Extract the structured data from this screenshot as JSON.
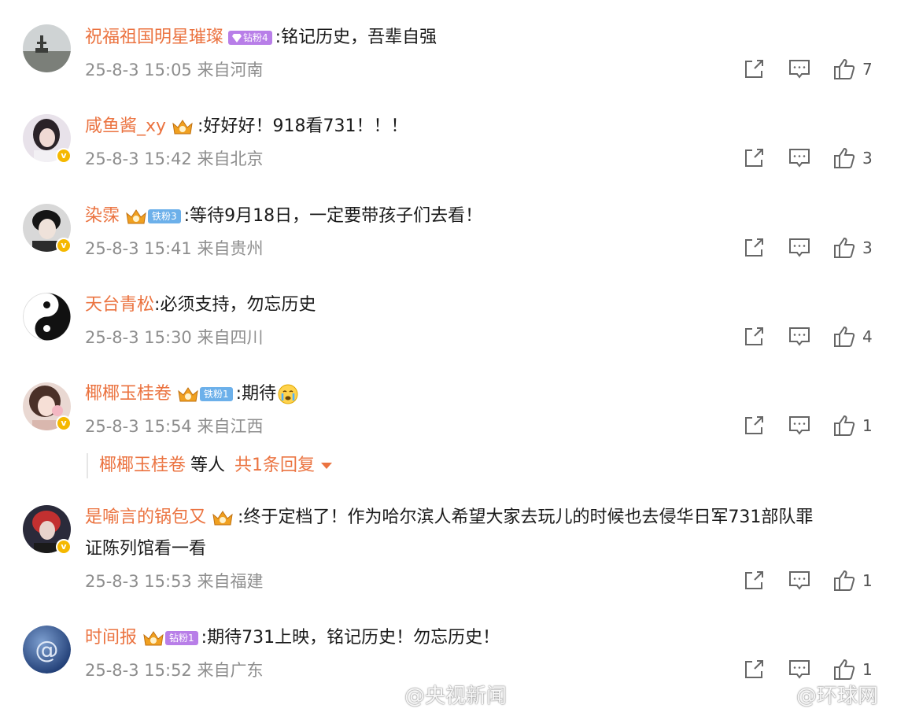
{
  "comments": [
    {
      "username": "祝福祖国明星璀璨",
      "fan_badge": {
        "crown": false,
        "type": "diamond-gem",
        "label": "钻粉4"
      },
      "text": "铭记历史，吾辈自强",
      "time": "25-8-3 15:05",
      "location": "来自河南",
      "likes": "7",
      "verified": false
    },
    {
      "username": "咸鱼酱_xy",
      "fan_badge": {
        "crown": true,
        "label": ""
      },
      "text": "好好好！918看731！！！",
      "time": "25-8-3 15:42",
      "location": "来自北京",
      "likes": "3",
      "verified": true
    },
    {
      "username": "染霂",
      "fan_badge": {
        "crown": true,
        "type": "iron",
        "label": "铁粉3"
      },
      "text": "等待9月18日，一定要带孩子们去看！",
      "time": "25-8-3 15:41",
      "location": "来自贵州",
      "likes": "3",
      "verified": true
    },
    {
      "username": "天台青松",
      "fan_badge": null,
      "text": "必须支持，勿忘历史",
      "time": "25-8-3 15:30",
      "location": "来自四川",
      "likes": "4",
      "verified": false
    },
    {
      "username": "椰椰玉桂卷",
      "fan_badge": {
        "crown": true,
        "type": "iron",
        "label": "铁粉1"
      },
      "text": "期待",
      "emoji": "crying-face",
      "time": "25-8-3 15:54",
      "location": "来自江西",
      "likes": "1",
      "verified": true
    },
    {
      "username": "是喻言的锅包又",
      "fan_badge": {
        "crown": true,
        "label": ""
      },
      "text": "终于定档了！作为哈尔滨人希望大家去玩儿的时候也去侵华日军731部队罪",
      "text_line2": "证陈列馆看一看",
      "time": "25-8-3 15:53",
      "location": "来自福建",
      "likes": "1",
      "verified": true
    },
    {
      "username": "时间报",
      "fan_badge": {
        "crown": true,
        "type": "diamond",
        "label": "钻粉1"
      },
      "text": "期待731上映，铭记历史！勿忘历史！",
      "time": "25-8-3 15:52",
      "location": "来自广东",
      "likes": "1",
      "verified": false
    }
  ],
  "reply_summary": {
    "name": "椰椰玉桂卷",
    "mid": "等人",
    "total": "共1条回复"
  },
  "colon": ":",
  "watermarks": [
    "@央视新闻",
    "@环球网"
  ],
  "colors": {
    "username": "#eb7340",
    "meta": "#8e8e8e",
    "iron_badge": "#6cb0ea",
    "diamond_badge": "#b87ee8",
    "verified": "#f5b800"
  }
}
